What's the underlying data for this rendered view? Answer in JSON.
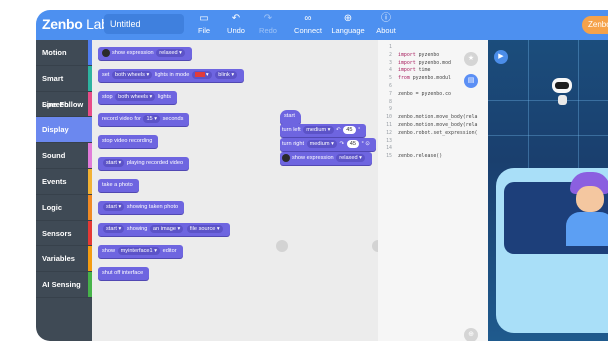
{
  "app": {
    "logo_main": "Zenbo",
    "logo_sub": "Lab",
    "project_name": "Untitled",
    "account_label": "Zenbo"
  },
  "toolbar": [
    {
      "id": "file",
      "icon": "folder-icon",
      "glyph": "▭",
      "label": "File",
      "disabled": false
    },
    {
      "id": "undo",
      "icon": "undo-icon",
      "glyph": "↶",
      "label": "Undo",
      "disabled": false
    },
    {
      "id": "redo",
      "icon": "redo-icon",
      "glyph": "↷",
      "label": "Redo",
      "disabled": true
    },
    {
      "id": "connect",
      "icon": "link-icon",
      "glyph": "∞",
      "label": "Connect",
      "disabled": false
    },
    {
      "id": "language",
      "icon": "globe-icon",
      "glyph": "⊕",
      "label": "Language",
      "disabled": false
    },
    {
      "id": "about",
      "icon": "info-icon",
      "glyph": "ⓘ",
      "label": "About",
      "disabled": false
    }
  ],
  "categories": [
    {
      "label": "Motion",
      "color": "#4f7df0",
      "active": false
    },
    {
      "label": "Smart Speech",
      "color": "#2db3a0",
      "active": false
    },
    {
      "label": "Line Follow",
      "color": "#e84c88",
      "active": false
    },
    {
      "label": "Display",
      "color": "#6b88ef",
      "active": true
    },
    {
      "label": "Sound",
      "color": "#e07bd9",
      "active": false
    },
    {
      "label": "Events",
      "color": "#f2b233",
      "active": false
    },
    {
      "label": "Logic",
      "color": "#f08a24",
      "active": false
    },
    {
      "label": "Sensors",
      "color": "#e53935",
      "active": false
    },
    {
      "label": "Variables",
      "color": "#f39c12",
      "active": false
    },
    {
      "label": "AI Sensing",
      "color": "#47b34a",
      "active": false
    }
  ],
  "palette_blocks": {
    "b1": {
      "text": "show expression",
      "dd": "relaxed"
    },
    "b2": {
      "a": "set",
      "dd1": "both wheels",
      "b": "lights in mode",
      "dd3": "blink"
    },
    "b3": {
      "a": "stop",
      "dd": "both wheels",
      "b": "lights"
    },
    "b4": {
      "a": "record video for",
      "num": "15",
      "b": "seconds"
    },
    "b5": {
      "a": "stop video recording"
    },
    "b6": {
      "dd": "start",
      "b": "playing recorded video"
    },
    "b7": {
      "a": "take a photo"
    },
    "b8": {
      "dd": "start",
      "b": "showing taken photo"
    },
    "b9": {
      "dd": "start",
      "b": "showing",
      "dd2": "an image",
      "dd3": "file source"
    },
    "b10": {
      "a": "show",
      "dd": "myinterface1",
      "b": "editor"
    },
    "b11": {
      "a": "shut off interface"
    }
  },
  "script_blocks": {
    "start": "start",
    "turn_left": {
      "a": "turn left",
      "dd": "medium",
      "num": "45"
    },
    "turn_right": {
      "a": "turn right",
      "dd": "medium",
      "num": "45"
    },
    "show_expression": {
      "a": "show expression",
      "dd": "relaxed"
    }
  },
  "code_lines": [
    {
      "n": "1",
      "kw": "",
      "tx": ""
    },
    {
      "n": "2",
      "kw": "import",
      "tx": " pyzenbo"
    },
    {
      "n": "3",
      "kw": "import",
      "tx": " pyzenbo.mod"
    },
    {
      "n": "4",
      "kw": "import",
      "tx": " time"
    },
    {
      "n": "5",
      "kw": "from",
      "tx": " pyzenbo.modul"
    },
    {
      "n": "6",
      "kw": "",
      "tx": ""
    },
    {
      "n": "7",
      "kw": "",
      "tx": "zenbo = pyzenbo.co"
    },
    {
      "n": "8",
      "kw": "",
      "tx": ""
    },
    {
      "n": "9",
      "kw": "",
      "tx": ""
    },
    {
      "n": "10",
      "kw": "",
      "tx": "zenbo.motion.move_body(rela"
    },
    {
      "n": "11",
      "kw": "",
      "tx": "zenbo.motion.move_body(rela"
    },
    {
      "n": "12",
      "kw": "",
      "tx": "zenbo.robot.set_expression("
    },
    {
      "n": "13",
      "kw": "",
      "tx": ""
    },
    {
      "n": "14",
      "kw": "",
      "tx": ""
    },
    {
      "n": "15",
      "kw": "",
      "tx": "zenbo.release()"
    }
  ],
  "colors": {
    "topbar": "#4d90f0",
    "block": "#6e65e0",
    "sidebar": "#3f4a55",
    "active_category": "#6b88ef",
    "stage": "#1b4d7c"
  }
}
